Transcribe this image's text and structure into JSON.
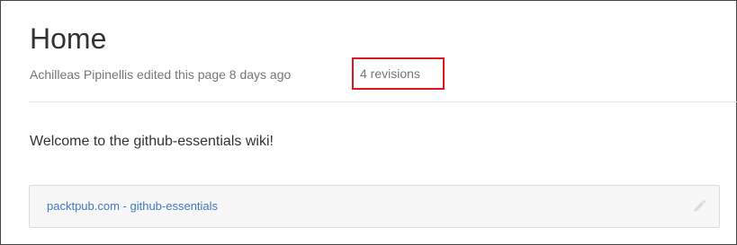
{
  "page": {
    "title": "Home",
    "meta_text": "Achilleas Pipinellis edited this page 8 days ago",
    "separator": "·",
    "revisions_label": "4 revisions",
    "content": "Welcome to the github-essentials wiki!"
  },
  "footer": {
    "link_text": "packtpub.com - github-essentials",
    "edit_icon": "pencil-icon"
  },
  "colors": {
    "highlight_border": "#e2121a",
    "link": "#4078c0",
    "muted_text": "#767676"
  }
}
